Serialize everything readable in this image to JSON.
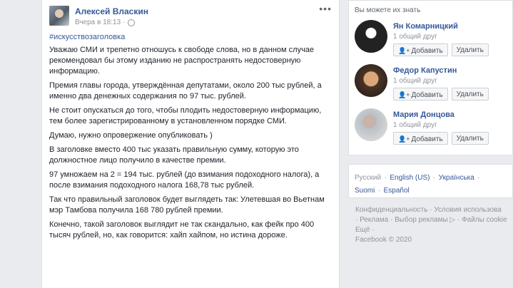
{
  "post": {
    "author": "Алексей Власкин",
    "time": "Вчера в 18:13 ·",
    "more_icon": "ellipsis-icon",
    "hashtag": "#искусствозаголовка",
    "paragraphs": [
      "Уважаю СМИ и трепетно отношусь к свободе слова, но в данном случае рекомендовал бы этому изданию не распространять недостоверную информацию.",
      "Премия главы города, утверждённая депутатами, около 200 тыс рублей, а именно два денежных содержания по 97 тыс. рублей.",
      "Не стоит опускаться до того, чтобы плодить недостоверную информацию, тем более зарегистрированному в установленном порядке СМИ.",
      "Думаю, нужно опровержение опубликовать )",
      "В заголовке вместо 400 тыс указать правильную сумму, которую это должностное лицо получило в качестве премии.",
      "97 умножаем на 2 = 194 тыс. рублей (до взимания подоходного налога), а после взимания подоходного налога 168,78 тыс рублей.",
      "Так что правильный заголовок будет выглядеть так: Улетевшая во Вьетнам мэр Тамбова получила 168 780 рублей премии.",
      "Конечно, такой заголовок выглядит не так скандально, как фейк про 400 тысяч рублей, но, как говорится: хайп хайпом, но истина дороже."
    ]
  },
  "pymk": {
    "title": "Вы можете их знать",
    "add_label": "Добавить",
    "remove_label": "Удалить",
    "people": [
      {
        "name": "Ян Комарницкий",
        "mutual": "1 общий друг"
      },
      {
        "name": "Федор Капустин",
        "mutual": "1 общий друг"
      },
      {
        "name": "Мария Донцова",
        "mutual": "1 общий друг"
      }
    ]
  },
  "languages": {
    "items": [
      "Русский",
      "English (US)",
      "Українська",
      "Suomi",
      "Español"
    ],
    "current": "Русский",
    "separator": "·"
  },
  "footer": {
    "links": [
      "Конфиденциальность",
      "Условия использова",
      "Реклама",
      "Выбор рекламы",
      "Файлы cookie",
      "Ещё"
    ],
    "copyright": "Facebook © 2020"
  },
  "colors": {
    "link": "#365899",
    "muted": "#90949c",
    "background": "#e9ebee"
  }
}
